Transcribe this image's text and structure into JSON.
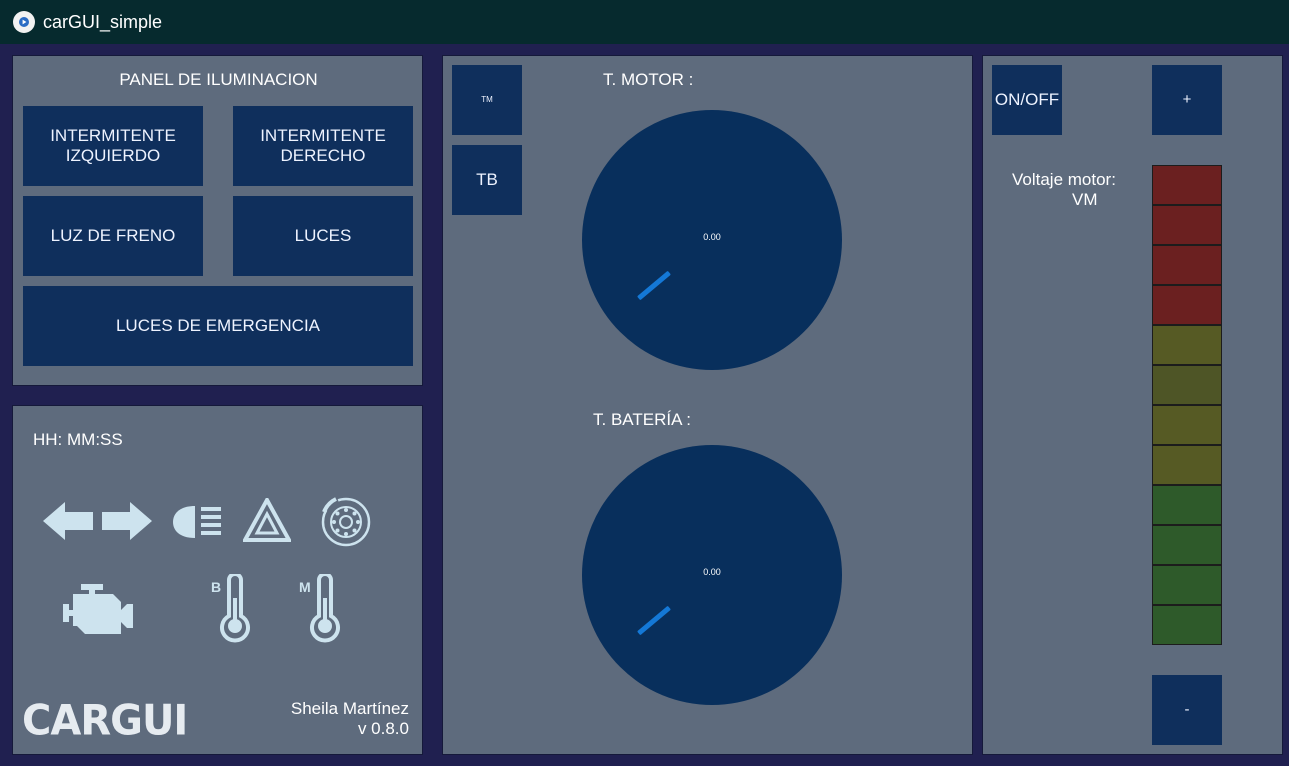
{
  "window": {
    "title": "carGUI_simple",
    "icon": "play-icon"
  },
  "lighting_panel": {
    "title": "PANEL DE ILUMINACION",
    "left_turn_label": "INTERMITENTE\nIZQUIERDO",
    "right_turn_label": "INTERMITENTE\nDERECHO",
    "brake_light_label": "LUZ DE FRENO",
    "lights_label": "LUCES",
    "emergency_label": "LUCES DE EMERGENCIA"
  },
  "status_panel": {
    "clock": "HH: MM:SS",
    "icons": [
      "arrow-left-icon",
      "arrow-right-icon",
      "headlight-icon",
      "hazard-icon",
      "brake-disc-icon",
      "engine-icon",
      "battery-thermometer-icon",
      "motor-thermometer-icon"
    ],
    "battery_thermo_letter": "B",
    "motor_thermo_letter": "M",
    "logo": "CARGUI",
    "author": "Sheila Martínez",
    "version": "v 0.8.0"
  },
  "temperature_panel": {
    "tm_button": "TM",
    "tb_button": "TB",
    "motor_label": "T. MOTOR :",
    "motor_value": "0.00",
    "battery_label": "T. BATERÍA :",
    "battery_value": "0.00"
  },
  "voltage_panel": {
    "onoff_label": "ON/OFF",
    "plus_label": "+",
    "minus_label": "-",
    "voltage_label": "Voltaje motor:",
    "voltage_value": "VM",
    "bar_colors": [
      "#6b2020",
      "#6b2020",
      "#6b2020",
      "#6b2020",
      "#565a24",
      "#4e5526",
      "#565a24",
      "#565a24",
      "#2e5a2a",
      "#2e5a2a",
      "#2e5a2a",
      "#2e5a2a"
    ]
  },
  "colors": {
    "panel": "#5e6b7d",
    "button": "#0f2f5c",
    "needle": "#1478d6",
    "frame": "#202050"
  }
}
